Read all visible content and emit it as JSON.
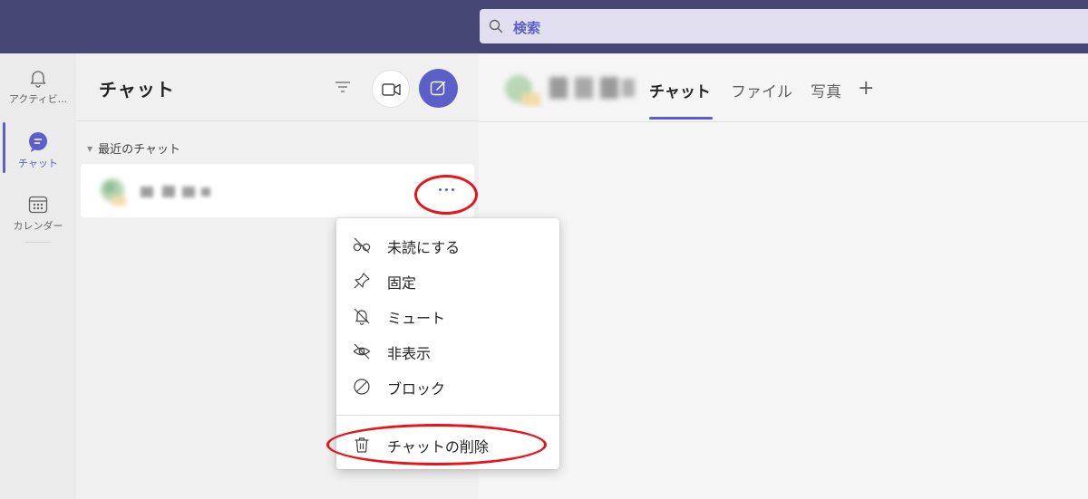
{
  "search": {
    "placeholder": "検索"
  },
  "rail": {
    "items": [
      {
        "label": "アクティビ...",
        "icon": "bell-icon"
      },
      {
        "label": "チャット",
        "icon": "chat-icon",
        "active": true
      },
      {
        "label": "カレンダー",
        "icon": "calendar-icon"
      }
    ]
  },
  "chatlist": {
    "title": "チャット",
    "section_label": "最近のチャット"
  },
  "main": {
    "tabs": [
      {
        "label": "チャット",
        "active": true
      },
      {
        "label": "ファイル"
      },
      {
        "label": "写真"
      }
    ],
    "add_tab": "+"
  },
  "context_menu": {
    "items": [
      {
        "label": "未読にする",
        "icon": "glasses-off-icon"
      },
      {
        "label": "固定",
        "icon": "pin-icon"
      },
      {
        "label": "ミュート",
        "icon": "bell-off-icon"
      },
      {
        "label": "非表示",
        "icon": "eye-off-icon"
      },
      {
        "label": "ブロック",
        "icon": "block-icon"
      },
      {
        "label": "チャットの削除",
        "icon": "trash-icon"
      }
    ]
  },
  "colors": {
    "topbar": "#464775",
    "accent": "#5b5fc7",
    "annotation": "#e8131b"
  }
}
